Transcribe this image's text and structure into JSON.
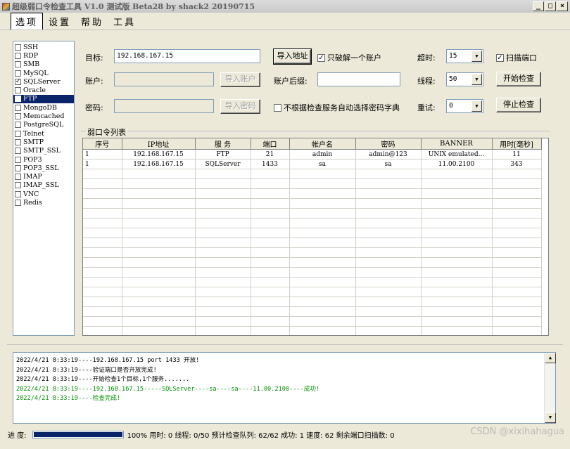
{
  "window": {
    "title": "超级弱口令检查工具 V1.0 测试版 Beta28 by shack2 20190715",
    "buttons": [
      "_",
      "□",
      "×"
    ]
  },
  "menu": [
    "选项",
    "设置",
    "帮助",
    "工具"
  ],
  "services": [
    {
      "label": "SSH",
      "checked": false
    },
    {
      "label": "RDP",
      "checked": false
    },
    {
      "label": "SMB",
      "checked": false
    },
    {
      "label": "MySQL",
      "checked": false
    },
    {
      "label": "SQLServer",
      "checked": true
    },
    {
      "label": "Oracle",
      "checked": false
    },
    {
      "label": "FTP",
      "checked": false,
      "selected": true
    },
    {
      "label": "MongoDB",
      "checked": false
    },
    {
      "label": "Memcached",
      "checked": false
    },
    {
      "label": "PostgreSQL",
      "checked": false
    },
    {
      "label": "Telnet",
      "checked": false
    },
    {
      "label": "SMTP",
      "checked": false
    },
    {
      "label": "SMTP_SSL",
      "checked": false
    },
    {
      "label": "POP3",
      "checked": false
    },
    {
      "label": "POP3_SSL",
      "checked": false
    },
    {
      "label": "IMAP",
      "checked": false
    },
    {
      "label": "IMAP_SSL",
      "checked": false
    },
    {
      "label": "VNC",
      "checked": false
    },
    {
      "label": "Redis",
      "checked": false
    }
  ],
  "form": {
    "target_label": "目标:",
    "target_value": "192.168.167.15",
    "import_address": "导入地址",
    "only_one_account": "只破解一个账户",
    "timeout_label": "超时:",
    "timeout_value": "15",
    "scan_port": "扫描端口",
    "account_label": "账户:",
    "import_account": "导入账户",
    "account_suffix_label": "账户后缀:",
    "threads_label": "线程:",
    "threads_value": "50",
    "start_button": "开始检查",
    "password_label": "密码:",
    "import_password": "导入密码",
    "no_auto_dict": "不根据检查服务自动选择密码字典",
    "retry_label": "重试:",
    "retry_value": "0",
    "stop_button": "停止检查"
  },
  "results": {
    "group_title": "弱口令列表",
    "columns": [
      "序号",
      "IP地址",
      "服 务",
      "端口",
      "帐户名",
      "密码",
      "BANNER",
      "用时[毫秒]"
    ],
    "rows": [
      [
        "1",
        "192.168.167.15",
        "FTP",
        "21",
        "admin",
        "admin@123",
        "UNIX emulated...",
        "11"
      ],
      [
        "1",
        "192.168.167.15",
        "SQLServer",
        "1433",
        "sa",
        "sa",
        "11.00.2100",
        "343"
      ]
    ]
  },
  "log": [
    {
      "text": "2022/4/21 8:33:19----192.168.167.15 port 1433 开放!",
      "color": "#000000"
    },
    {
      "text": "2022/4/21 8:33:19----验证端口是否开放完成!",
      "color": "#000000"
    },
    {
      "text": "2022/4/21 8:33:19----开始检查1个目标,1个服务.......",
      "color": "#000000"
    },
    {
      "text": "2022/4/21 8:33:19----192.168.167.15-----SQLServer----sa----sa----11.00.2100----成功!",
      "color": "#009000"
    },
    {
      "text": "2022/4/21 8:33:19----检查完成!",
      "color": "#009000"
    }
  ],
  "status": {
    "progress_label": "进 度:",
    "progress_fraction": 1.0,
    "text": "100% 用时: 0 线程: 0/50 预计检查队列: 62/62 成功: 1 速度: 62 剩余端口扫描数: 0"
  },
  "watermark": "CSDN @xixihahagua"
}
